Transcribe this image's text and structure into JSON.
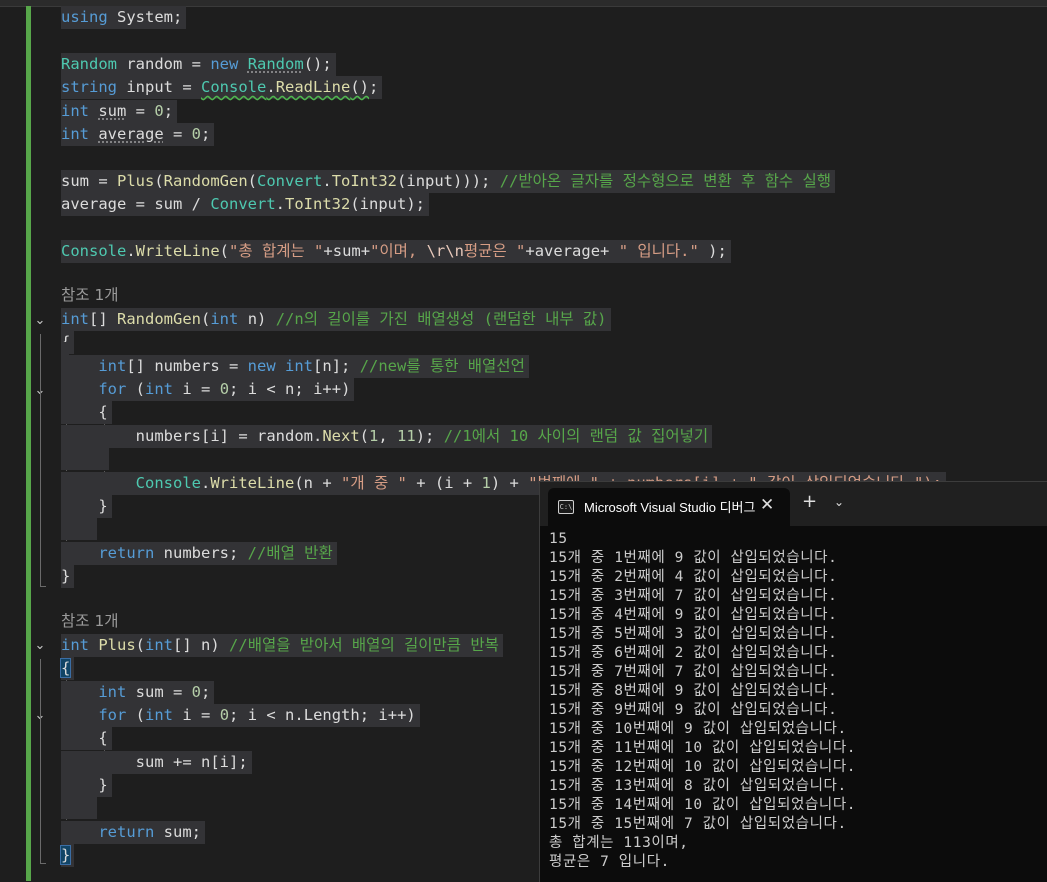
{
  "editor": {
    "code": {
      "using_kw": "using",
      "using_ns": "System",
      "random_type": "Random",
      "random_var": "random",
      "new_kw": "new",
      "random_ctor": "Random",
      "string_kw": "string",
      "input_var": "input",
      "console_cls": "Console",
      "readline_fn": "ReadLine",
      "int_kw": "int",
      "sum_var": "sum",
      "average_var": "average",
      "zero": "0",
      "plus_fn": "Plus",
      "randomgen_fn": "RandomGen",
      "convert_cls": "Convert",
      "toint32_fn": "ToInt32",
      "comment_convert": "//받아온 글자를 정수형으로 변환 후 함수 실행",
      "writeline_fn": "WriteLine",
      "str_total": "\"총 합계는 \"",
      "str_mid_a": "\"이며, ",
      "str_mid_esc": "\\r\\n",
      "str_mid_b": "평균은 \"",
      "str_end": "\" 입니다.\"",
      "ref_count_1": "참조 1개",
      "comment_randomgen": "//n의 길이를 가진 배열생성 (랜덤한 내부 값)",
      "numbers_var": "numbers",
      "n_var": "n",
      "comment_new": "//new를 통한 배열선언",
      "for_kw": "for",
      "i_var": "i",
      "next_fn": "Next",
      "one": "1",
      "eleven": "11",
      "comment_next": "//1에서 10 사이의 랜덤 값 집어넣기",
      "str_count_of": "\"개 중 \"",
      "str_cut": "\"번째에 \" + numbers[i] + \" 값이 삽입되었습니다.\");",
      "return_kw": "return",
      "comment_return": "//배열 반환",
      "ref_count_2": "참조 1개",
      "comment_plus": "//배열을 받아서 배열의 길이만큼 반복",
      "length_prop": "Length"
    }
  },
  "console_window": {
    "tab_icon": "C:\\",
    "tab_title": "Microsoft Visual Studio 디버그",
    "close_glyph": "✕",
    "new_tab_glyph": "+",
    "menu_glyph": "⌄",
    "output": [
      "15",
      "15개 중 1번째에 9 값이 삽입되었습니다.",
      "15개 중 2번째에 4 값이 삽입되었습니다.",
      "15개 중 3번째에 7 값이 삽입되었습니다.",
      "15개 중 4번째에 9 값이 삽입되었습니다.",
      "15개 중 5번째에 3 값이 삽입되었습니다.",
      "15개 중 6번째에 2 값이 삽입되었습니다.",
      "15개 중 7번째에 7 값이 삽입되었습니다.",
      "15개 중 8번째에 9 값이 삽입되었습니다.",
      "15개 중 9번째에 9 값이 삽입되었습니다.",
      "15개 중 10번째에 9 값이 삽입되었습니다.",
      "15개 중 11번째에 10 값이 삽입되었습니다.",
      "15개 중 12번째에 10 값이 삽입되었습니다.",
      "15개 중 13번째에 8 값이 삽입되었습니다.",
      "15개 중 14번째에 10 값이 삽입되었습니다.",
      "15개 중 15번째에 7 값이 삽입되었습니다.",
      "총 합계는 113이며,",
      "평균은 7 입니다."
    ]
  }
}
